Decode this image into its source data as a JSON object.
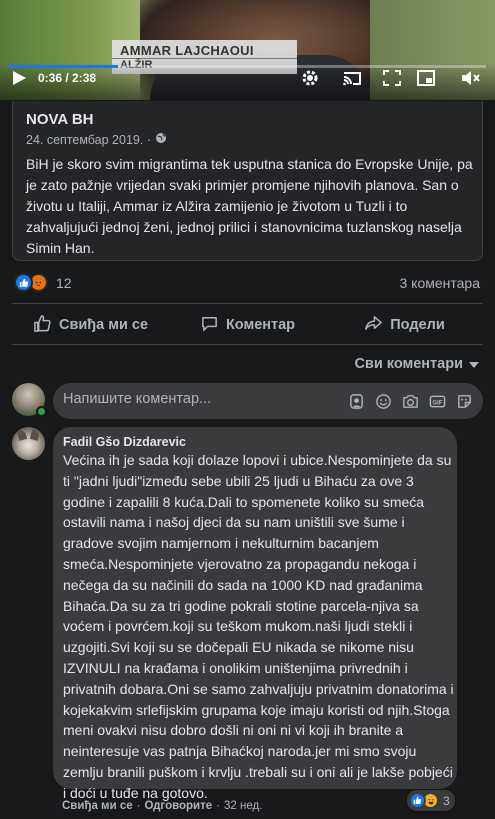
{
  "video": {
    "lower_third_name": "AMMAR LAJCHAOUI",
    "lower_third_place": "ALŽIR",
    "time": "0:36 / 2:38",
    "progress_fraction": 0.23
  },
  "post": {
    "source": "NOVA BH",
    "date": "24. септембар 2019. ·",
    "text": "BiH je skoro svim migrantima tek usputna stanica do Evropske Unije, pa je zato pažnje vrijedan svaki primjer promjene njihovih planova. San o životu u Italiji, Ammar iz Alžira zamijenio je životom u Tuzli i to zahvaljujući jednoj ženi, jednoj prilici i stanovnicima tuzlanskog naselja Simin Han."
  },
  "stats": {
    "reaction_count": "12",
    "comments_count": "3 коментара"
  },
  "actions": {
    "like": "Свиђа ми се",
    "comment": "Коментар",
    "share": "Подели"
  },
  "sort_label": "Сви коментари",
  "composer": {
    "placeholder": "Напишите коментар..."
  },
  "comment": {
    "author": "Fadil Gšo Dizdarevic",
    "text": "Većina ih je sada koji dolaze lopovi i ubice.Nespominjete da su ti \"jadni ljudi\"između sebe ubili 25 ljudi u Bihaću za ove 3 godine i zapalili 8 kuća.Dali to spomenete koliko su smeća ostavili nama i našoj djeci da su nam uništili sve šume i gradove svojim namjernom i nekulturnim bacanjem smeća.Nespominjete vjerovatno za propagandu nekoga i nečega da su načinili do sada na 1000 KD nad građanima Bihaća.Da su za tri godine pokrali stotine parcela-njiva sa voćem i povrćem.koji su teškom mukom.naši ljudi stekli i uzgojiti.Svi koji su se dočepali EU nikada se nikome nisu IZVINULI na krađama i onolikim uništenjima privrednih i privatnih dobara.Oni se samo zahvaljuju privatnim donatorima i kojekakvim srlefijskim grupama koje imaju koristi od njih.Stoga meni ovakvi nisu dobro došli ni oni ni vi koji ih branite a neinteresuje vas patnja Bihaćkoj naroda.jer mi smo svoju zemlju branili puškom i krvlju .trebali su i oni ali je lakše pobjeći i doći u tuđe na gotovo.",
    "like_label": "Свиђа ми се",
    "sep1": "·",
    "reply_label": "Одговорите",
    "sep2": "·",
    "age": "32 нед.",
    "reaction_count": "3"
  },
  "colors": {
    "background": "#18191a",
    "card": "#242526",
    "bubble": "#3a3b3c",
    "accent": "#1877f2"
  }
}
